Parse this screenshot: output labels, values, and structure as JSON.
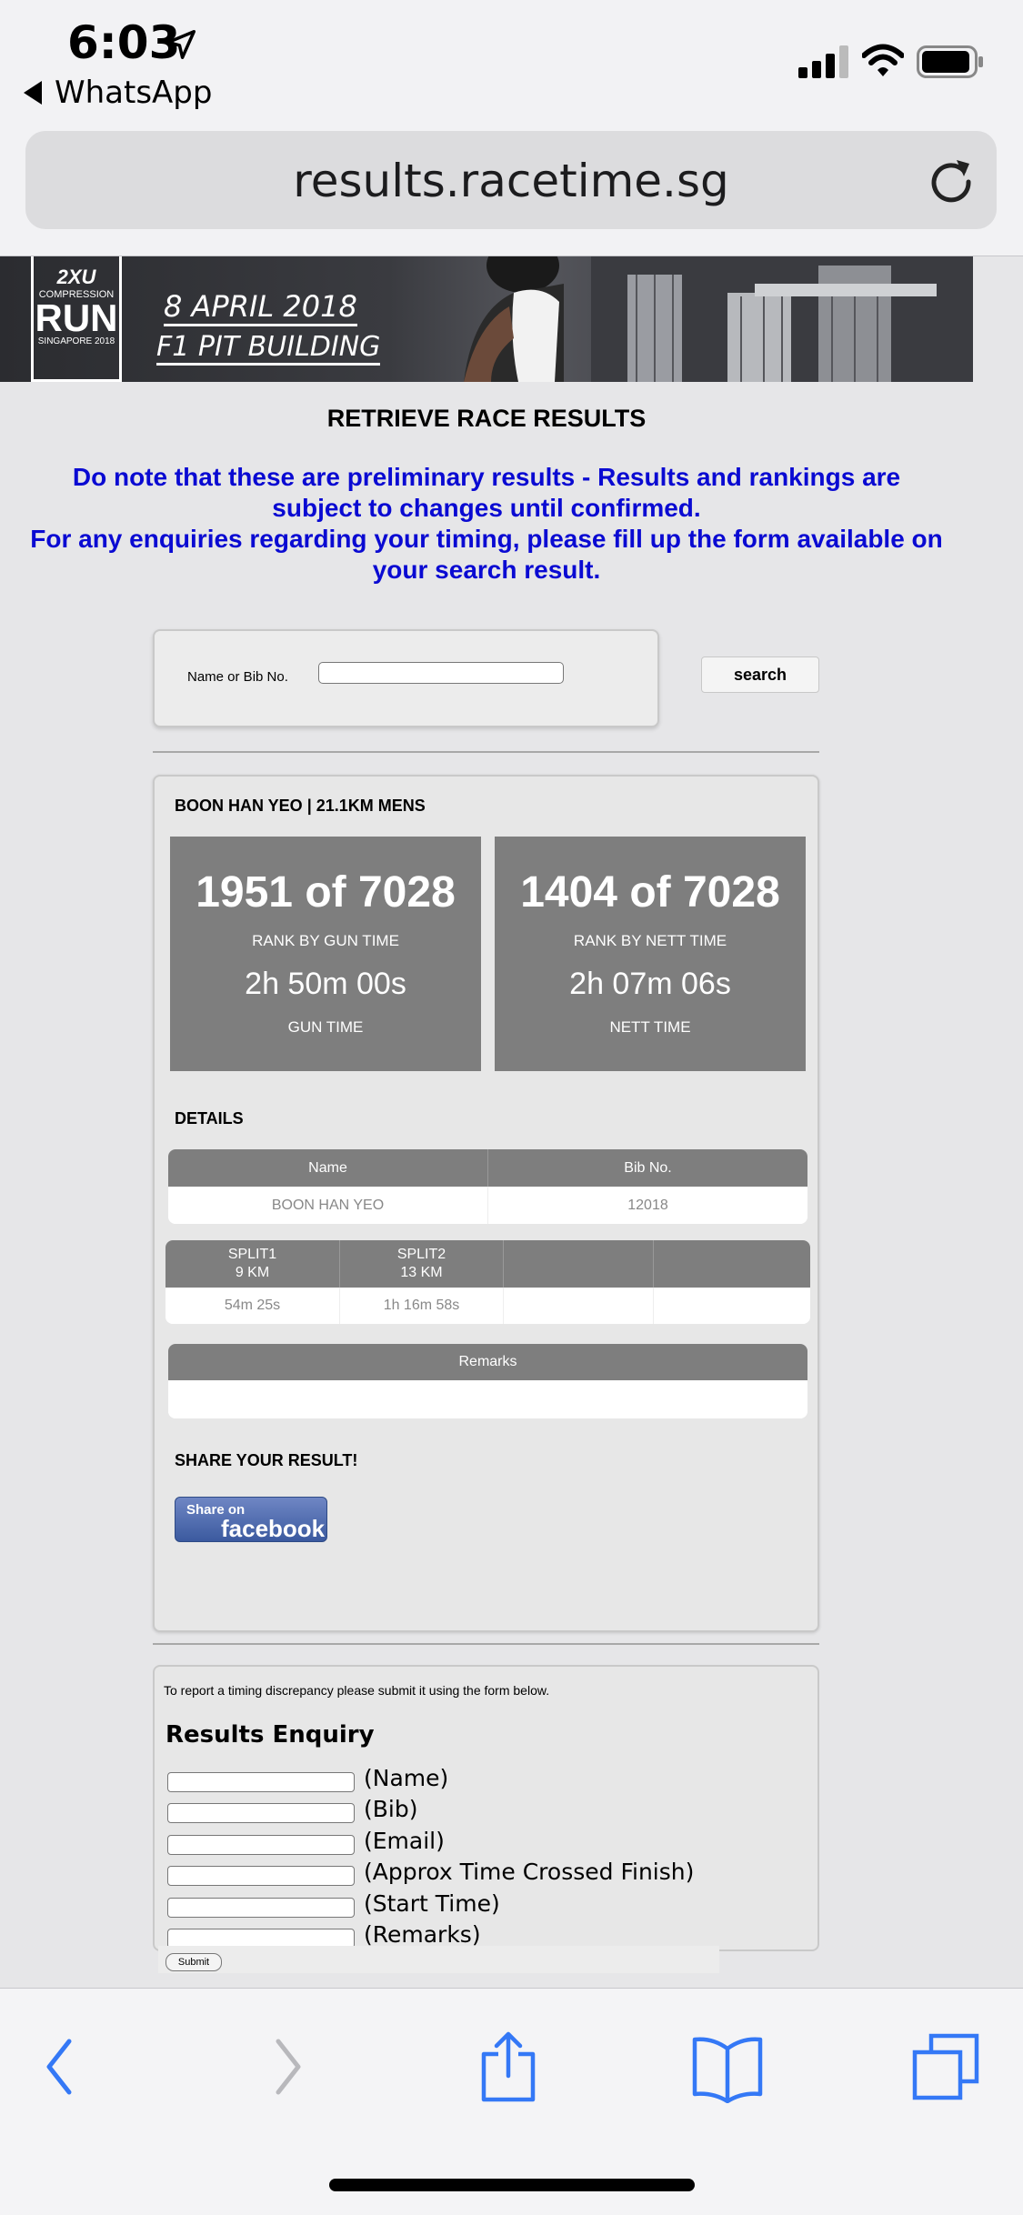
{
  "status": {
    "time": "6:03",
    "back_app": "WhatsApp"
  },
  "browser": {
    "url": "results.racetime.sg"
  },
  "banner": {
    "logo_brand": "2XU",
    "logo_line1": "COMPRESSION",
    "logo_line2": "RUN",
    "logo_line3": "SINGAPORE 2018",
    "date": "8 APRIL 2018",
    "venue": "F1 PIT BUILDING"
  },
  "page": {
    "heading": "RETRIEVE RACE RESULTS",
    "notice_line1": "Do note that these are preliminary results - Results and rankings are subject to changes until confirmed.",
    "notice_line2": "For any enquiries regarding your timing, please fill up the form available on your search result."
  },
  "search": {
    "label": "Name or Bib No.",
    "value": "",
    "button": "search"
  },
  "result": {
    "title": "BOON HAN YEO | 21.1KM MENS",
    "gun": {
      "rank": "1951 of 7028",
      "rank_label": "RANK BY GUN TIME",
      "time": "2h 50m 00s",
      "time_label": "GUN TIME"
    },
    "nett": {
      "rank": "1404 of 7028",
      "rank_label": "RANK BY NETT TIME",
      "time": "2h 07m 06s",
      "time_label": "NETT TIME"
    },
    "details_title": "DETAILS",
    "details_headers": [
      "Name",
      "Bib No."
    ],
    "details_values": [
      "BOON HAN YEO",
      "12018"
    ],
    "splits": [
      {
        "name": "SPLIT1",
        "dist": "9 KM",
        "time": "54m 25s"
      },
      {
        "name": "SPLIT2",
        "dist": "13 KM",
        "time": "1h 16m 58s"
      }
    ],
    "remarks_header": "Remarks",
    "remarks_value": "",
    "share_title": "SHARE YOUR RESULT!",
    "share_small": "Share on",
    "share_big": "facebook"
  },
  "enquiry": {
    "note": "To report a timing discrepancy please submit it using the form below.",
    "title": "Results Enquiry",
    "fields": [
      "(Name)",
      "(Bib)",
      "(Email)",
      "(Approx Time Crossed Finish)",
      "(Start Time)",
      "(Remarks)"
    ],
    "submit": "Submit"
  },
  "colors": {
    "notice": "#0a0ad2",
    "card": "#7e7e7e",
    "ios_blue": "#3478f6"
  }
}
